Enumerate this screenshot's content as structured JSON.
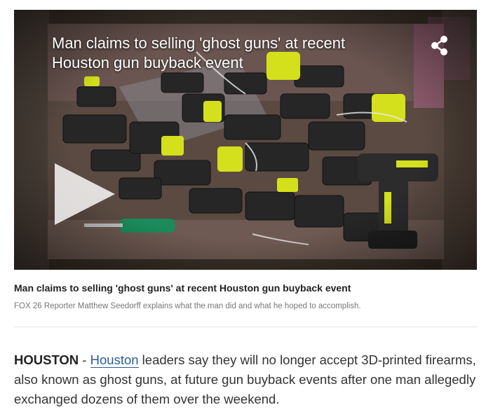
{
  "video": {
    "title": "Man claims to selling 'ghost guns' at recent Houston gun buyback event",
    "share_icon": "share-icon",
    "play_icon": "play-icon"
  },
  "caption": {
    "title": "Man claims to selling 'ghost guns' at recent Houston gun buyback event",
    "description": "FOX 26 Reporter Matthew Seedorff explains what the man did and what he hoped to accomplish."
  },
  "article": {
    "dateline": "HOUSTON",
    "separator": " - ",
    "link_text": "Houston",
    "body_text": " leaders say they will no longer accept 3D-printed firearms, also known as ghost guns, at future gun buyback events after one man allegedly exchanged dozens of them over the weekend."
  },
  "colors": {
    "link": "#2a5c9a",
    "gun_body": "#2b2b2b",
    "gun_accent": "#d4e01c"
  }
}
